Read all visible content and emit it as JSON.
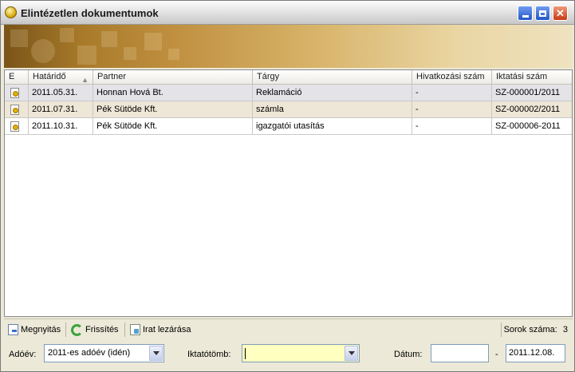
{
  "window": {
    "title": "Elintézetlen dokumentumok"
  },
  "grid": {
    "columns": [
      {
        "label": "E"
      },
      {
        "label": "Határidő",
        "sorted": "ascending"
      },
      {
        "label": "Partner"
      },
      {
        "label": "Tárgy"
      },
      {
        "label": "Hivatkozási szám"
      },
      {
        "label": "Iktatási szám"
      }
    ],
    "rows": [
      {
        "deadline": "2011.05.31.",
        "partner": "Honnan Hová Bt.",
        "subject": "Reklamáció",
        "reference": "-",
        "registry": "SZ-000001/2011"
      },
      {
        "deadline": "2011.07.31.",
        "partner": "Pék Sütöde Kft.",
        "subject": "számla",
        "reference": "-",
        "registry": "SZ-000002/2011"
      },
      {
        "deadline": "2011.10.31.",
        "partner": "Pék Sütöde Kft.",
        "subject": "igazgatói utasítás",
        "reference": "-",
        "registry": "SZ-000006-2011"
      }
    ]
  },
  "toolbar": {
    "open_label": "Megnyitás",
    "refresh_label": "Frissítés",
    "close_doc_label": "Irat lezárása",
    "row_count_label": "Sorok száma:",
    "row_count": "3"
  },
  "filters": {
    "tax_year_label": "Adóév:",
    "tax_year_value": "2011-es adóév (idén)",
    "registry_book_label": "Iktatótömb:",
    "registry_book_value": "",
    "date_label": "Dátum:",
    "date_from": "",
    "date_separator": "-",
    "date_to": "2011.12.08."
  },
  "colors": {
    "selected_row": "#e3e3e8",
    "alt_row": "#eee6d6",
    "highlight_input": "#ffffc0"
  }
}
